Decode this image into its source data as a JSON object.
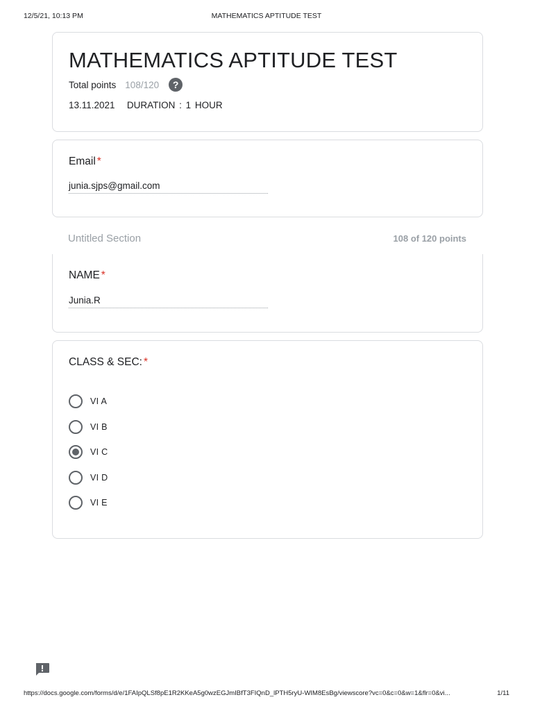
{
  "print_header": {
    "datetime": "12/5/21, 10:13 PM",
    "doc_title": "MATHEMATICS APTITUDE TEST"
  },
  "form": {
    "title": "MATHEMATICS APTITUDE TEST",
    "total_points_label": "Total points",
    "total_points_value": "108/120",
    "help_icon": "question-mark",
    "description": "13.11.2021   DURATION : 1 HOUR"
  },
  "email_question": {
    "label": "Email",
    "required_mark": "*",
    "answer": "junia.sjps@gmail.com"
  },
  "section": {
    "title": "Untitled Section",
    "points": "108 of 120 points"
  },
  "name_question": {
    "label": "NAME",
    "required_mark": "*",
    "answer": "Junia.R"
  },
  "class_question": {
    "label": "CLASS & SEC:",
    "required_mark": "*",
    "options": [
      {
        "label": "VI A",
        "selected": false
      },
      {
        "label": "VI B",
        "selected": false
      },
      {
        "label": "VI C",
        "selected": true
      },
      {
        "label": "VI D",
        "selected": false
      },
      {
        "label": "VI E",
        "selected": false
      }
    ]
  },
  "feedback_icon": "report-exclamation-icon",
  "print_footer": {
    "url": "https://docs.google.com/forms/d/e/1FAIpQLSf8pE1R2KKeA5g0wzEGJmIBfT3FIQnD_lPTH5ryU-WIM8EsBg/viewscore?vc=0&c=0&w=1&flr=0&vi...",
    "page": "1/11"
  },
  "colors": {
    "text": "#202124",
    "muted": "#9aa0a6",
    "required": "#d93025",
    "border": "#dadce0",
    "icon": "#5f6368"
  }
}
